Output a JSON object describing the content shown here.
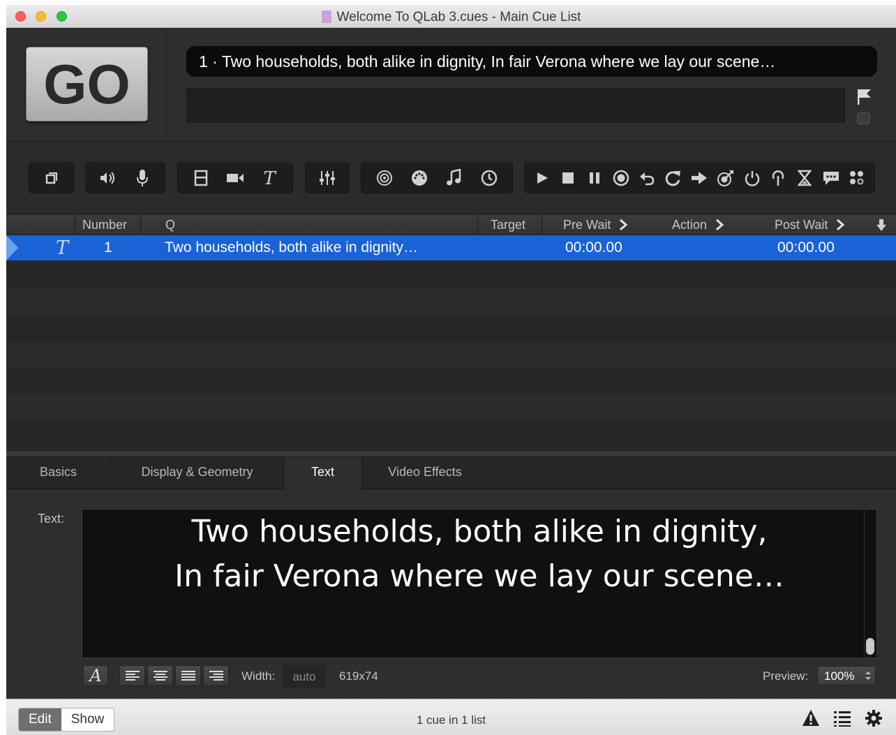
{
  "window": {
    "title": "Welcome To QLab 3.cues - Main Cue List"
  },
  "go_button": {
    "label": "GO"
  },
  "standby": {
    "text": "1 · Two households, both alike in dignity, In fair Verona where we lay our scene…"
  },
  "toolbar": {
    "groups": [
      [
        "group-cue-icon"
      ],
      [
        "audio-icon",
        "mic-icon"
      ],
      [
        "video-icon",
        "camera-icon",
        "text-icon"
      ],
      [
        "fade-icon"
      ],
      [
        "network-icon",
        "midi-icon",
        "midi-file-icon",
        "timecode-icon"
      ],
      [
        "start-icon",
        "stop-icon",
        "pause-icon",
        "load-icon",
        "reset-icon",
        "devamp-icon",
        "goto-icon",
        "target-icon",
        "arm-icon",
        "disarm-icon",
        "wait-icon",
        "memo-icon",
        "script-icon"
      ]
    ]
  },
  "cue_list": {
    "columns": {
      "number": "Number",
      "q": "Q",
      "target": "Target",
      "pre_wait": "Pre Wait",
      "action": "Action",
      "post_wait": "Post Wait"
    },
    "rows": [
      {
        "type_icon": "text-icon",
        "number": "1",
        "q": "Two households, both alike in dignity…",
        "target": "",
        "pre_wait": "00:00.00",
        "action": "",
        "post_wait": "00:00.00",
        "selected": true
      }
    ]
  },
  "inspector": {
    "tabs": [
      "Basics",
      "Display & Geometry",
      "Text",
      "Video Effects"
    ],
    "active_tab": "Text",
    "text_label": "Text:",
    "text_line1": "Two households, both alike in dignity,",
    "text_line2": "In fair Verona where we lay our scene…",
    "width_label": "Width:",
    "width_value": "auto",
    "size": "619x74",
    "preview_label": "Preview:",
    "preview_value": "100%"
  },
  "footer": {
    "mode_edit": "Edit",
    "mode_show": "Show",
    "active_mode": "Edit",
    "status": "1 cue in 1 list"
  },
  "colors": {
    "selection": "#1a63d6",
    "background": "#2b2b2b"
  }
}
